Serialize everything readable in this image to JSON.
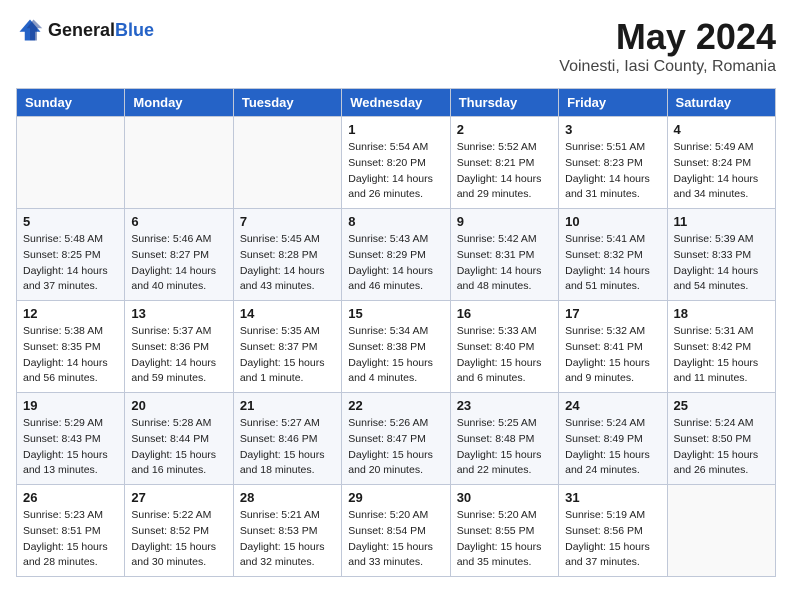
{
  "header": {
    "logo_general": "General",
    "logo_blue": "Blue",
    "month_title": "May 2024",
    "location": "Voinesti, Iasi County, Romania"
  },
  "weekdays": [
    "Sunday",
    "Monday",
    "Tuesday",
    "Wednesday",
    "Thursday",
    "Friday",
    "Saturday"
  ],
  "weeks": [
    [
      {
        "day": "",
        "info": ""
      },
      {
        "day": "",
        "info": ""
      },
      {
        "day": "",
        "info": ""
      },
      {
        "day": "1",
        "info": "Sunrise: 5:54 AM\nSunset: 8:20 PM\nDaylight: 14 hours and 26 minutes."
      },
      {
        "day": "2",
        "info": "Sunrise: 5:52 AM\nSunset: 8:21 PM\nDaylight: 14 hours and 29 minutes."
      },
      {
        "day": "3",
        "info": "Sunrise: 5:51 AM\nSunset: 8:23 PM\nDaylight: 14 hours and 31 minutes."
      },
      {
        "day": "4",
        "info": "Sunrise: 5:49 AM\nSunset: 8:24 PM\nDaylight: 14 hours and 34 minutes."
      }
    ],
    [
      {
        "day": "5",
        "info": "Sunrise: 5:48 AM\nSunset: 8:25 PM\nDaylight: 14 hours and 37 minutes."
      },
      {
        "day": "6",
        "info": "Sunrise: 5:46 AM\nSunset: 8:27 PM\nDaylight: 14 hours and 40 minutes."
      },
      {
        "day": "7",
        "info": "Sunrise: 5:45 AM\nSunset: 8:28 PM\nDaylight: 14 hours and 43 minutes."
      },
      {
        "day": "8",
        "info": "Sunrise: 5:43 AM\nSunset: 8:29 PM\nDaylight: 14 hours and 46 minutes."
      },
      {
        "day": "9",
        "info": "Sunrise: 5:42 AM\nSunset: 8:31 PM\nDaylight: 14 hours and 48 minutes."
      },
      {
        "day": "10",
        "info": "Sunrise: 5:41 AM\nSunset: 8:32 PM\nDaylight: 14 hours and 51 minutes."
      },
      {
        "day": "11",
        "info": "Sunrise: 5:39 AM\nSunset: 8:33 PM\nDaylight: 14 hours and 54 minutes."
      }
    ],
    [
      {
        "day": "12",
        "info": "Sunrise: 5:38 AM\nSunset: 8:35 PM\nDaylight: 14 hours and 56 minutes."
      },
      {
        "day": "13",
        "info": "Sunrise: 5:37 AM\nSunset: 8:36 PM\nDaylight: 14 hours and 59 minutes."
      },
      {
        "day": "14",
        "info": "Sunrise: 5:35 AM\nSunset: 8:37 PM\nDaylight: 15 hours and 1 minute."
      },
      {
        "day": "15",
        "info": "Sunrise: 5:34 AM\nSunset: 8:38 PM\nDaylight: 15 hours and 4 minutes."
      },
      {
        "day": "16",
        "info": "Sunrise: 5:33 AM\nSunset: 8:40 PM\nDaylight: 15 hours and 6 minutes."
      },
      {
        "day": "17",
        "info": "Sunrise: 5:32 AM\nSunset: 8:41 PM\nDaylight: 15 hours and 9 minutes."
      },
      {
        "day": "18",
        "info": "Sunrise: 5:31 AM\nSunset: 8:42 PM\nDaylight: 15 hours and 11 minutes."
      }
    ],
    [
      {
        "day": "19",
        "info": "Sunrise: 5:29 AM\nSunset: 8:43 PM\nDaylight: 15 hours and 13 minutes."
      },
      {
        "day": "20",
        "info": "Sunrise: 5:28 AM\nSunset: 8:44 PM\nDaylight: 15 hours and 16 minutes."
      },
      {
        "day": "21",
        "info": "Sunrise: 5:27 AM\nSunset: 8:46 PM\nDaylight: 15 hours and 18 minutes."
      },
      {
        "day": "22",
        "info": "Sunrise: 5:26 AM\nSunset: 8:47 PM\nDaylight: 15 hours and 20 minutes."
      },
      {
        "day": "23",
        "info": "Sunrise: 5:25 AM\nSunset: 8:48 PM\nDaylight: 15 hours and 22 minutes."
      },
      {
        "day": "24",
        "info": "Sunrise: 5:24 AM\nSunset: 8:49 PM\nDaylight: 15 hours and 24 minutes."
      },
      {
        "day": "25",
        "info": "Sunrise: 5:24 AM\nSunset: 8:50 PM\nDaylight: 15 hours and 26 minutes."
      }
    ],
    [
      {
        "day": "26",
        "info": "Sunrise: 5:23 AM\nSunset: 8:51 PM\nDaylight: 15 hours and 28 minutes."
      },
      {
        "day": "27",
        "info": "Sunrise: 5:22 AM\nSunset: 8:52 PM\nDaylight: 15 hours and 30 minutes."
      },
      {
        "day": "28",
        "info": "Sunrise: 5:21 AM\nSunset: 8:53 PM\nDaylight: 15 hours and 32 minutes."
      },
      {
        "day": "29",
        "info": "Sunrise: 5:20 AM\nSunset: 8:54 PM\nDaylight: 15 hours and 33 minutes."
      },
      {
        "day": "30",
        "info": "Sunrise: 5:20 AM\nSunset: 8:55 PM\nDaylight: 15 hours and 35 minutes."
      },
      {
        "day": "31",
        "info": "Sunrise: 5:19 AM\nSunset: 8:56 PM\nDaylight: 15 hours and 37 minutes."
      },
      {
        "day": "",
        "info": ""
      }
    ]
  ]
}
